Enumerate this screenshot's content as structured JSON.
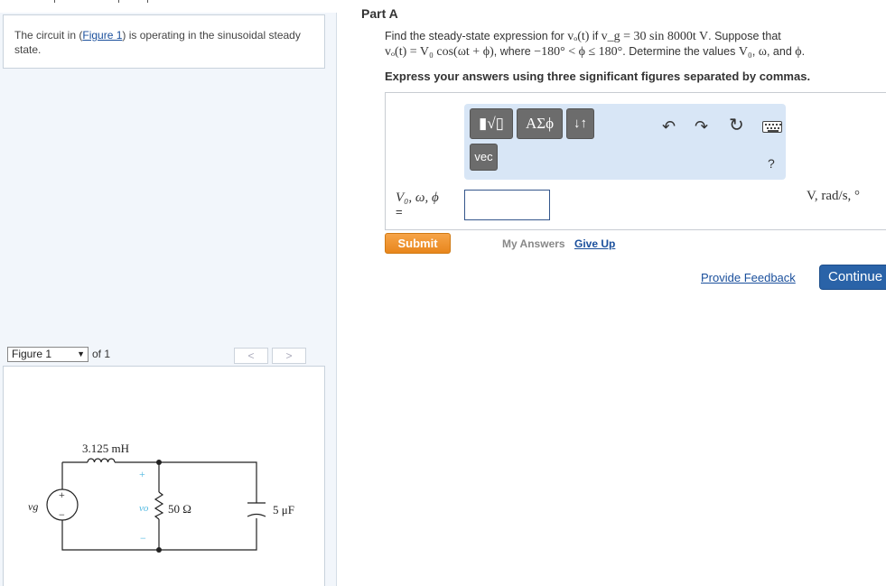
{
  "intro": {
    "text_before": "The circuit in (",
    "figure_link": "Figure 1",
    "text_after": ") is operating in the sinusoidal steady state."
  },
  "figure_nav": {
    "selected": "Figure 1",
    "of_label": "of 1",
    "prev": "<",
    "next": ">"
  },
  "circuit": {
    "inductor_label": "3.125 mH",
    "resistor_label": "50 Ω",
    "capacitor_label": "5 μF",
    "source_label": "vg",
    "source_plus": "+",
    "source_minus": "−",
    "output_label": "vo",
    "output_plus": "+",
    "output_minus": "−"
  },
  "part": {
    "title": "Part A",
    "line1_a": "Find the steady-state expression for ",
    "line1_m1": "vₒ(t)",
    "line1_b": " if ",
    "line1_m2": "v_g = 30 sin 8000t V",
    "line1_c": ". Suppose that",
    "line2_m1": "vₒ(t) = V₀ cos(ωt + ϕ)",
    "line2_a": ", where ",
    "line2_m2": "−180° < ϕ ≤ 180°",
    "line2_b": ". Determine the values ",
    "line2_m3": "V₀",
    "line2_c": ", ",
    "line2_m4": "ω",
    "line2_d": ", and ",
    "line2_m5": "ϕ",
    "line2_e": ".",
    "instruction": "Express your answers using three significant figures separated by commas."
  },
  "toolbar": {
    "template_btn": "▮√▯",
    "greek_btn": "ΑΣϕ",
    "arrows_btn": "↓↑",
    "vec_btn": "vec",
    "help": "?"
  },
  "answer": {
    "variables": "V₀, ω, ϕ",
    "equals": "=",
    "value": "",
    "units": "V, rad/s, °"
  },
  "actions": {
    "submit": "Submit",
    "my_answers": "My Answers",
    "give_up": "Give Up",
    "feedback": "Provide Feedback",
    "continue": "Continue"
  },
  "colors": {
    "link": "#1a4f9c",
    "submit": "#e8861c",
    "continue": "#2a63a8",
    "toolbar_bg": "#d8e6f6",
    "output_label": "#4fb8e0"
  }
}
